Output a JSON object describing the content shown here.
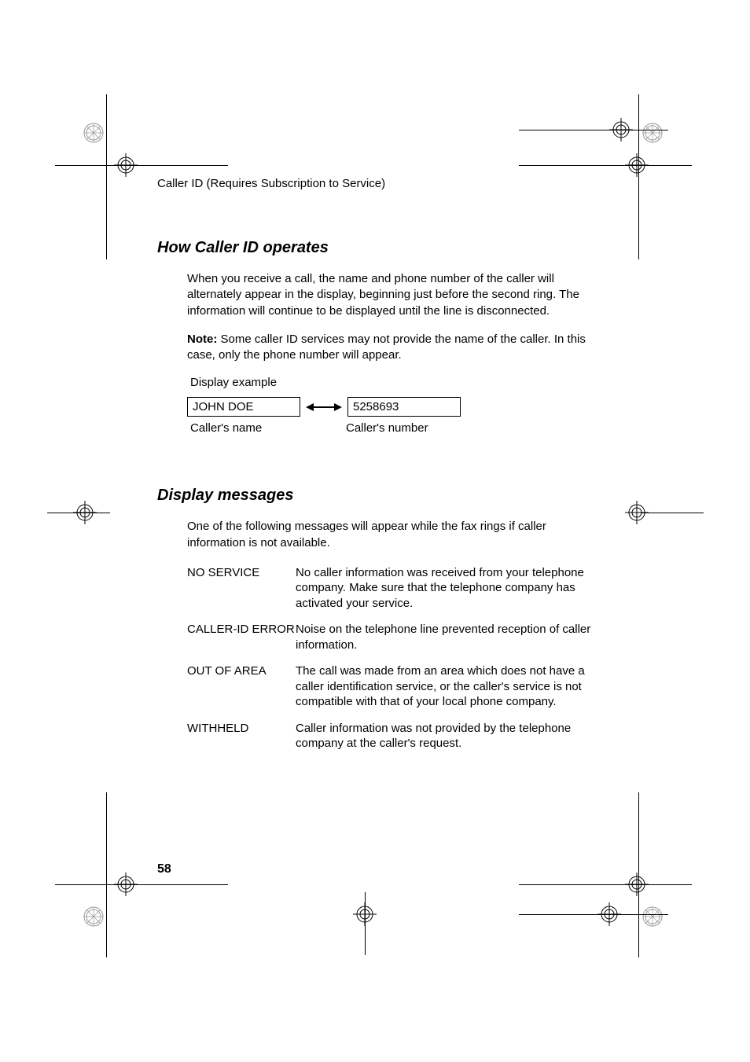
{
  "header": {
    "running_head": "Caller ID (Requires Subscription to Service)"
  },
  "section1": {
    "title": "How Caller ID operates",
    "para1": "When you receive a call, the name and phone number of the caller will alternately appear in the display, beginning just before the second ring. The information will continue to be displayed until the line is disconnected.",
    "note_label": "Note:",
    "note_text": " Some caller ID services may not provide the name of the caller. In this case, only the phone number will appear.",
    "example_label": "Display example",
    "example_name": "JOHN DOE",
    "example_number": "5258693",
    "sub_name": "Caller's name",
    "sub_number": "Caller's number"
  },
  "section2": {
    "title": "Display messages",
    "intro": "One of the following messages will appear while the fax rings if caller information is not available.",
    "rows": [
      {
        "key": "NO SERVICE",
        "val": "No caller information was received from your telephone company. Make sure that the telephone company has activated your service."
      },
      {
        "key": "CALLER-ID ERROR",
        "val": "Noise on the telephone line prevented reception of caller information."
      },
      {
        "key": "OUT OF AREA",
        "val": "The call was made from an area which does not have a caller identification service, or the caller's service is not compatible with that of your local phone company."
      },
      {
        "key": "WITHHELD",
        "val": "Caller information was not provided by the telephone company at the caller's request."
      }
    ]
  },
  "page_number": "58"
}
